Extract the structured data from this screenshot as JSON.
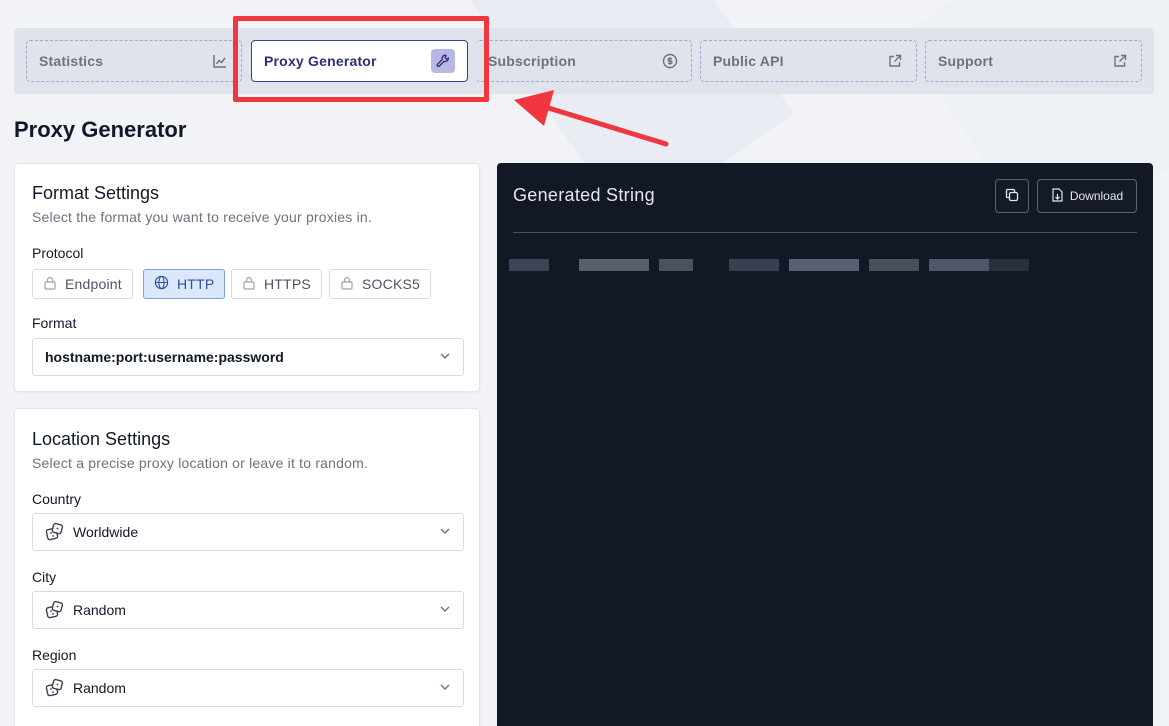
{
  "nav": {
    "tabs": [
      {
        "label": "Statistics",
        "icon": "chart-icon"
      },
      {
        "label": "Proxy Generator",
        "icon": "wrench-icon",
        "active": true
      },
      {
        "label": "Subscription",
        "icon": "dollar-circle-icon"
      },
      {
        "label": "Public API",
        "icon": "external-link-icon"
      },
      {
        "label": "Support",
        "icon": "external-link-icon"
      }
    ]
  },
  "page": {
    "title": "Proxy Generator"
  },
  "format_settings": {
    "title": "Format Settings",
    "subtitle": "Select the format you want to receive your proxies in.",
    "protocol_label": "Protocol",
    "protocols": [
      {
        "label": "Endpoint",
        "icon": "lock-icon"
      },
      {
        "label": "HTTP",
        "icon": "globe-icon",
        "active": true
      },
      {
        "label": "HTTPS",
        "icon": "lock-icon"
      },
      {
        "label": "SOCKS5",
        "icon": "lock-icon"
      }
    ],
    "format_label": "Format",
    "format_value": "hostname:port:username:password"
  },
  "location_settings": {
    "title": "Location Settings",
    "subtitle": "Select a precise proxy location or leave it to random.",
    "country_label": "Country",
    "country_value": "Worldwide",
    "city_label": "City",
    "city_value": "Random",
    "region_label": "Region",
    "region_value": "Random"
  },
  "output": {
    "title": "Generated String",
    "download_label": "Download"
  },
  "colors": {
    "accent": "#2d2f7a",
    "highlight": "#f0363f",
    "dark_panel": "#131827"
  }
}
